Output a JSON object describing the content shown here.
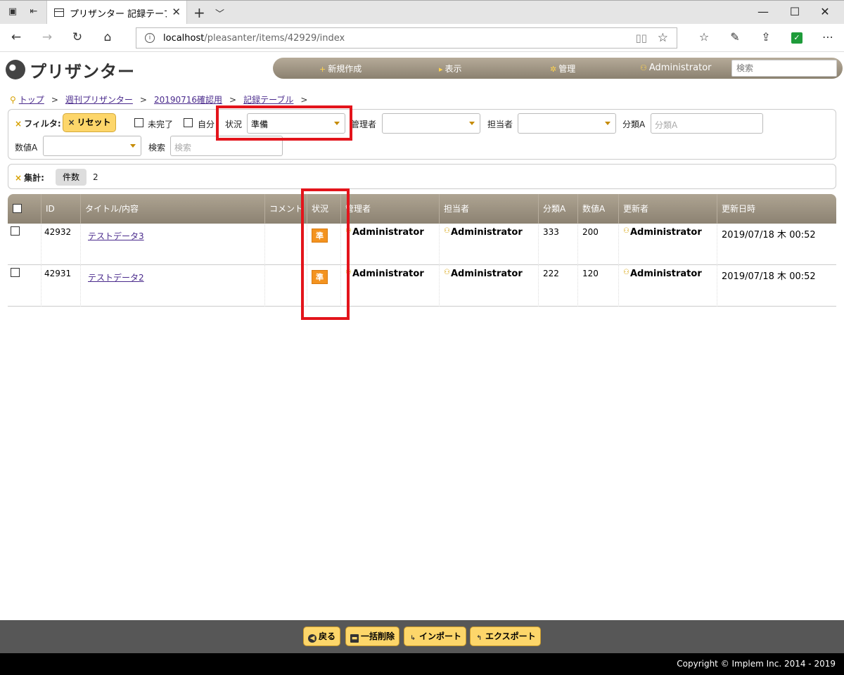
{
  "browser": {
    "tab_title": "プリザンター 記録テーブル サ",
    "url_host": "localhost",
    "url_path": "/pleasanter/items/42929/index"
  },
  "app": {
    "logo_text": "プリザンター",
    "menu": {
      "new": "新規作成",
      "view": "表示",
      "manage": "管理",
      "user": "Administrator",
      "search_placeholder": "検索"
    }
  },
  "breadcrumb": [
    "トップ",
    "週刊プリザンター",
    "20190716確認用",
    "記録テーブル"
  ],
  "filter": {
    "label": "フィルタ:",
    "reset": "リセット",
    "incomplete": "未完了",
    "self": "自分",
    "status_label": "状況",
    "status_value": "準備",
    "manager_label": "管理者",
    "owner_label": "担当者",
    "class_label": "分類A",
    "class_placeholder": "分類A",
    "num_label": "数値A",
    "search_label": "検索",
    "search_placeholder": "検索"
  },
  "aggregate": {
    "label": "集計:",
    "count_label": "件数",
    "count_value": "2"
  },
  "grid": {
    "headers": [
      "ID",
      "タイトル/内容",
      "コメント",
      "状況",
      "管理者",
      "担当者",
      "分類A",
      "数値A",
      "更新者",
      "更新日時"
    ],
    "rows": [
      {
        "id": "42932",
        "title": "テストデータ3",
        "status": "準",
        "manager": "Administrator",
        "owner": "Administrator",
        "class_a": "333",
        "num_a": "200",
        "updater": "Administrator",
        "updated": "2019/07/18 木 00:52"
      },
      {
        "id": "42931",
        "title": "テストデータ2",
        "status": "準",
        "manager": "Administrator",
        "owner": "Administrator",
        "class_a": "222",
        "num_a": "120",
        "updater": "Administrator",
        "updated": "2019/07/18 木 00:52"
      }
    ]
  },
  "footer": {
    "back": "戻る",
    "bulk_delete": "一括削除",
    "import": "インポート",
    "export": "エクスポート",
    "copyright": "Copyright © Implem Inc. 2014 - 2019"
  },
  "colors": {
    "accent": "#fdd66a",
    "status_badge": "#f3931f",
    "highlight": "#e3141b"
  }
}
